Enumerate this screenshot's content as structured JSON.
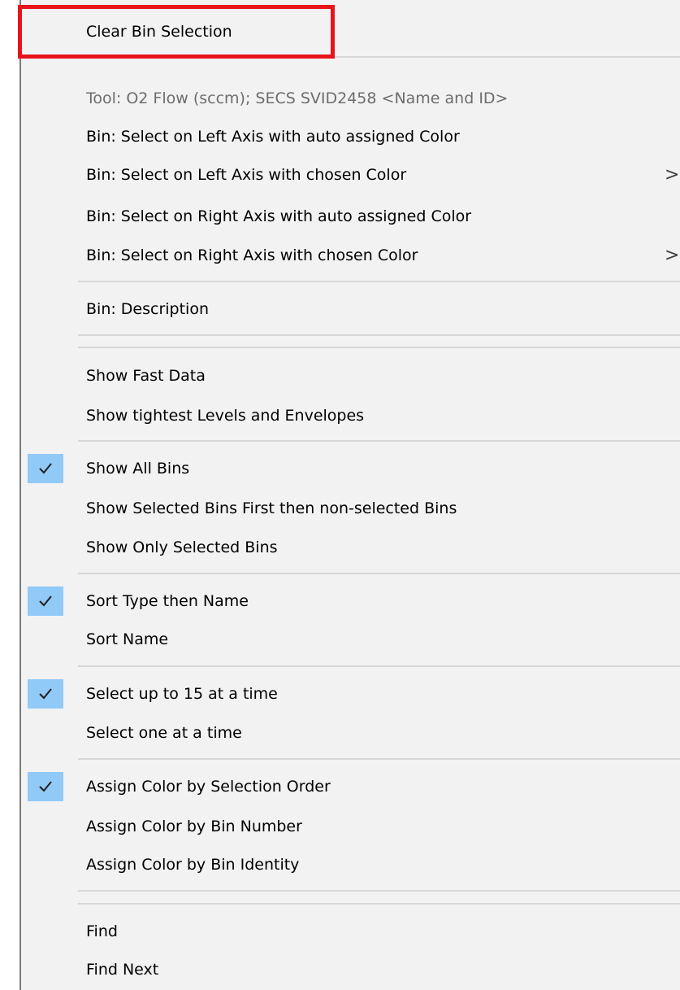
{
  "menu": {
    "items": [
      {
        "label": "Clear Bin Selection"
      },
      {
        "label": "Tool: O2 Flow (sccm); SECS SVID2458 <Name and ID>",
        "disabled": true
      },
      {
        "label": "Bin: Select on Left Axis with auto assigned Color"
      },
      {
        "label": "Bin: Select on Left Axis with chosen Color",
        "submenu_arrow": ">"
      },
      {
        "label": "Bin: Select on Right Axis with auto assigned Color"
      },
      {
        "label": "Bin: Select on Right Axis with chosen Color",
        "submenu_arrow": ">"
      },
      {
        "label": "Bin: Description"
      },
      {
        "label": "Show Fast Data"
      },
      {
        "label": "Show tightest Levels and Envelopes"
      },
      {
        "label": "Show All Bins",
        "checked": true
      },
      {
        "label": "Show Selected Bins First then non-selected Bins"
      },
      {
        "label": "Show Only Selected Bins"
      },
      {
        "label": "Sort Type then Name",
        "checked": true
      },
      {
        "label": "Sort Name"
      },
      {
        "label": "Select up to 15 at a time",
        "checked": true
      },
      {
        "label": "Select one at a time"
      },
      {
        "label": "Assign Color by Selection Order",
        "checked": true
      },
      {
        "label": "Assign Color by Bin Number"
      },
      {
        "label": "Assign Color by Bin Identity"
      },
      {
        "label": "Find"
      },
      {
        "label": "Find Next"
      }
    ]
  },
  "colors": {
    "menu_background": "#f2f2f2",
    "check_highlight": "#91c9f7",
    "annotation_box": "#e8141c",
    "disabled_text": "#6d6d6d",
    "separator": "#d7d7d7"
  },
  "icons": {
    "check": "check-icon",
    "submenu": "chevron-right-icon"
  }
}
